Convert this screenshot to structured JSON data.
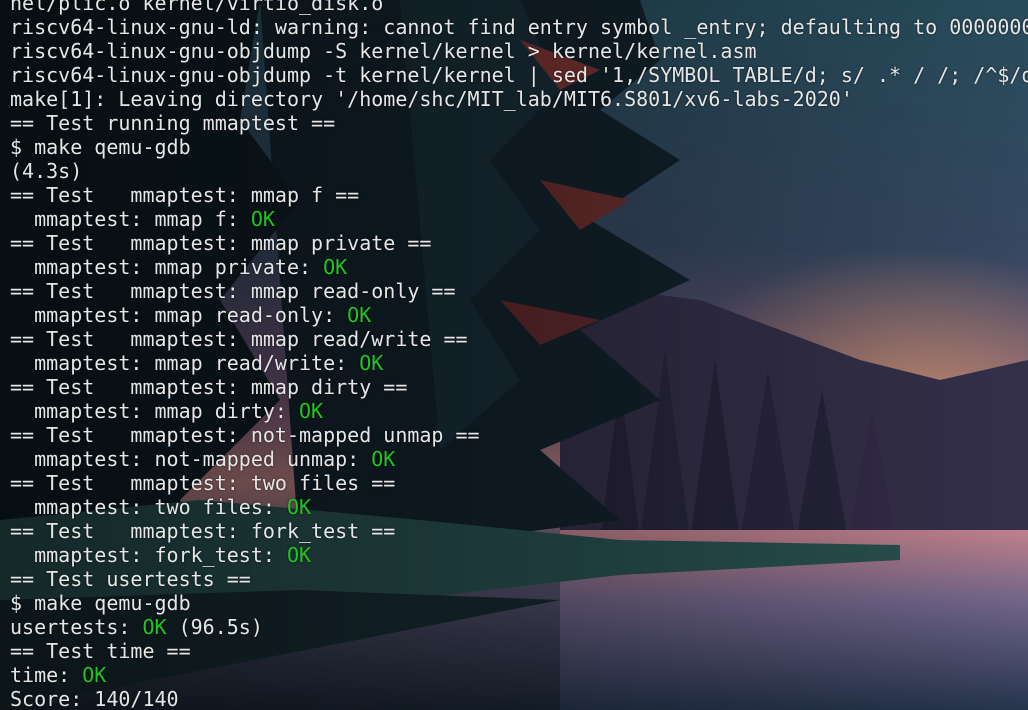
{
  "theme": {
    "text_color": "#e6e6e6",
    "ok_color": "#21c421"
  },
  "terminal": {
    "lines": [
      {
        "text": "nel/plic.o kernel/virtio_disk.o",
        "status": ""
      },
      {
        "text": "riscv64-linux-gnu-ld: warning: cannot find entry symbol _entry; defaulting to 0000000",
        "status": ""
      },
      {
        "text": "riscv64-linux-gnu-objdump -S kernel/kernel > kernel/kernel.asm",
        "status": ""
      },
      {
        "text": "riscv64-linux-gnu-objdump -t kernel/kernel | sed '1,/SYMBOL TABLE/d; s/ .* / /; /^$/d",
        "status": ""
      },
      {
        "text": "make[1]: Leaving directory '/home/shc/MIT_lab/MIT6.S801/xv6-labs-2020'",
        "status": ""
      },
      {
        "text": "== Test running mmaptest ==",
        "status": ""
      },
      {
        "text": "$ make qemu-gdb",
        "status": ""
      },
      {
        "text": "(4.3s)",
        "status": ""
      },
      {
        "text": "== Test   mmaptest: mmap f ==",
        "status": ""
      },
      {
        "text": "  mmaptest: mmap f: ",
        "status": "OK"
      },
      {
        "text": "== Test   mmaptest: mmap private ==",
        "status": ""
      },
      {
        "text": "  mmaptest: mmap private: ",
        "status": "OK"
      },
      {
        "text": "== Test   mmaptest: mmap read-only ==",
        "status": ""
      },
      {
        "text": "  mmaptest: mmap read-only: ",
        "status": "OK"
      },
      {
        "text": "== Test   mmaptest: mmap read/write ==",
        "status": ""
      },
      {
        "text": "  mmaptest: mmap read/write: ",
        "status": "OK"
      },
      {
        "text": "== Test   mmaptest: mmap dirty ==",
        "status": ""
      },
      {
        "text": "  mmaptest: mmap dirty: ",
        "status": "OK"
      },
      {
        "text": "== Test   mmaptest: not-mapped unmap ==",
        "status": ""
      },
      {
        "text": "  mmaptest: not-mapped unmap: ",
        "status": "OK"
      },
      {
        "text": "== Test   mmaptest: two files ==",
        "status": ""
      },
      {
        "text": "  mmaptest: two files: ",
        "status": "OK"
      },
      {
        "text": "== Test   mmaptest: fork_test ==",
        "status": ""
      },
      {
        "text": "  mmaptest: fork_test: ",
        "status": "OK"
      },
      {
        "text": "== Test usertests ==",
        "status": ""
      },
      {
        "text": "$ make qemu-gdb",
        "status": ""
      },
      {
        "text": "usertests: ",
        "status": "OK",
        "suffix": " (96.5s)"
      },
      {
        "text": "== Test time ==",
        "status": ""
      },
      {
        "text": "time: ",
        "status": "OK"
      },
      {
        "text": "Score: 140/140",
        "status": ""
      }
    ]
  }
}
